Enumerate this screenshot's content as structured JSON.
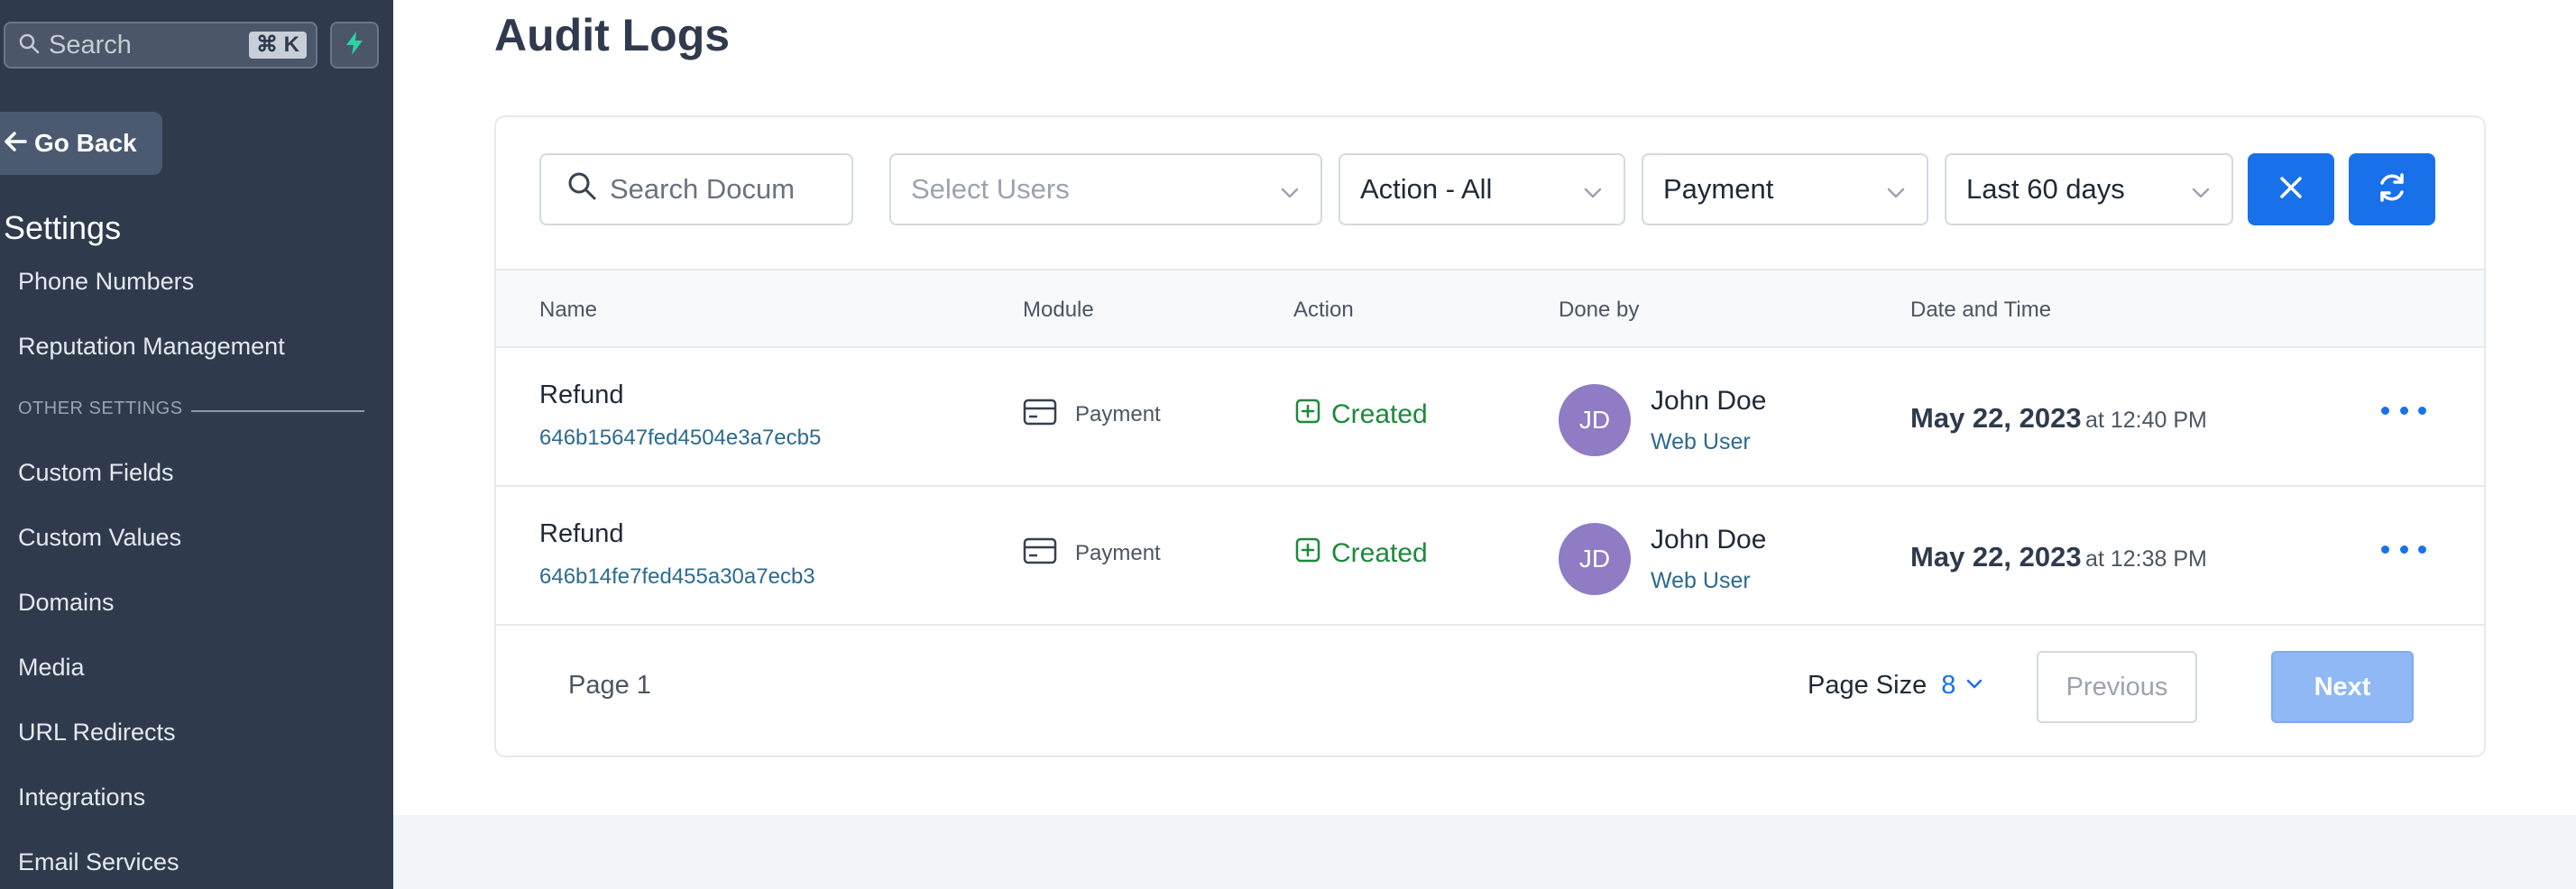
{
  "sidebar": {
    "search_placeholder": "Search",
    "search_shortcut": "⌘ K",
    "go_back_label": "Go Back",
    "settings_title": "Settings",
    "items_top": [
      "Phone Numbers",
      "Reputation Management"
    ],
    "other_settings_label": "OTHER SETTINGS",
    "items_other": [
      "Custom Fields",
      "Custom Values",
      "Domains",
      "Media",
      "URL Redirects",
      "Integrations",
      "Email Services"
    ]
  },
  "main": {
    "page_title": "Audit Logs",
    "filters": {
      "search_placeholder": "Search Docum",
      "users_placeholder": "Select Users",
      "action_value": "Action - All",
      "module_value": "Payment",
      "range_value": "Last 60 days"
    },
    "columns": [
      "Name",
      "Module",
      "Action",
      "Done by",
      "Date and Time"
    ],
    "rows": [
      {
        "name": "Refund",
        "id": "646b15647fed4504e3a7ecb5",
        "module": "Payment",
        "action": "Created",
        "avatar_initials": "JD",
        "user_name": "John Doe",
        "user_role": "Web User",
        "date": "May 22, 2023",
        "time": "at 12:40 PM"
      },
      {
        "name": "Refund",
        "id": "646b14fe7fed455a30a7ecb3",
        "module": "Payment",
        "action": "Created",
        "avatar_initials": "JD",
        "user_name": "John Doe",
        "user_role": "Web User",
        "date": "May 22, 2023",
        "time": "at 12:38 PM"
      }
    ],
    "pagination": {
      "page_label": "Page 1",
      "page_size_label": "Page Size",
      "page_size_value": "8",
      "previous_label": "Previous",
      "next_label": "Next"
    }
  },
  "icons": {
    "search": "search-icon",
    "bolt": "bolt-icon",
    "back": "arrow-left-icon",
    "chevron": "chevron-down-icon",
    "clear": "close-icon",
    "refresh": "refresh-icon",
    "module": "credit-card-icon",
    "action": "plus-square-icon",
    "more": "ellipsis-icon"
  },
  "colors": {
    "sidebar_bg": "#2f3b4d",
    "accent": "#1971e9",
    "success": "#1c8a3a",
    "avatar": "#8f7cc4",
    "link": "#2c6b8f"
  }
}
